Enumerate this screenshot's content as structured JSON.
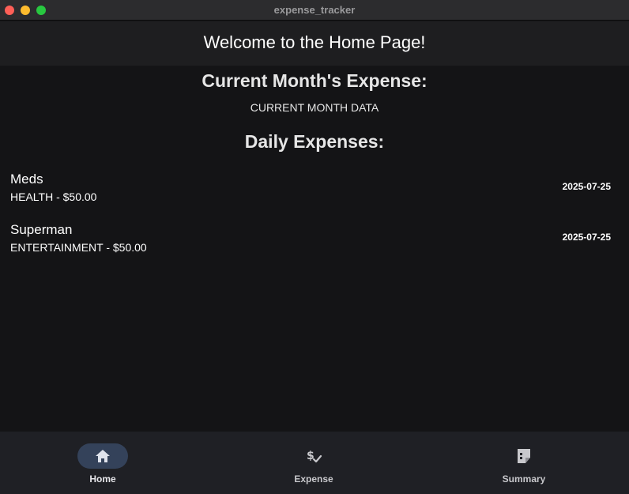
{
  "window": {
    "title": "expense_tracker"
  },
  "appbar": {
    "title": "Welcome to the Home Page!"
  },
  "main": {
    "current_month_heading": "Current Month's Expense:",
    "current_month_data": "CURRENT MONTH DATA",
    "daily_heading": "Daily Expenses:",
    "expenses": [
      {
        "name": "Meds",
        "subtitle": "HEALTH - $50.00",
        "date": "2025-07-25"
      },
      {
        "name": "Superman",
        "subtitle": "ENTERTAINMENT - $50.00",
        "date": "2025-07-25"
      }
    ]
  },
  "bottom_nav": {
    "selected": "Home",
    "items": [
      {
        "label": "Home",
        "icon": "home-icon"
      },
      {
        "label": "Expense",
        "icon": "price-check-icon"
      },
      {
        "label": "Summary",
        "icon": "summary-note-icon"
      }
    ]
  },
  "colors": {
    "background": "#141416",
    "appbar": "#1e1e20",
    "nav_background": "#1f2025",
    "nav_selected_pill": "#34425a"
  }
}
